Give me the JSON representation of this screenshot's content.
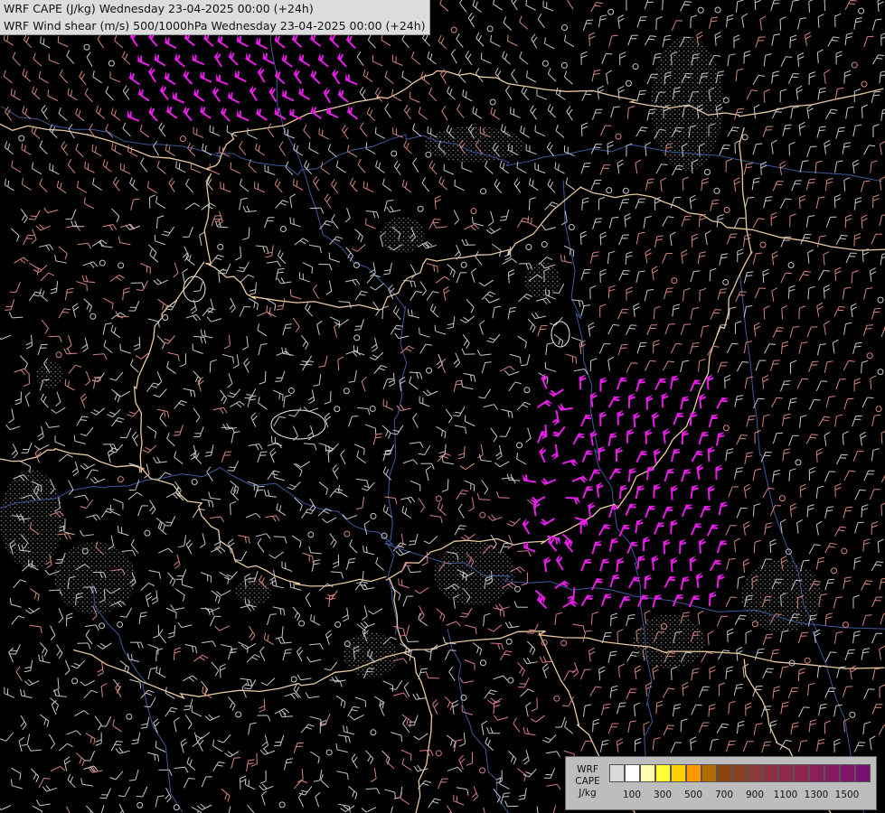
{
  "header": {
    "title_line1": "WRF CAPE (J/kg) Wednesday 23-04-2025 00:00 (+24h)",
    "title_line2": "WRF Wind shear (m/s) 500/1000hPa Wednesday 23-04-2025 00:00 (+24h)"
  },
  "legend": {
    "label_line1": "WRF",
    "label_line2": "CAPE",
    "label_line3": "J/kg",
    "colors": [
      "#d9d9d9",
      "#ffffff",
      "#ffffb0",
      "#ffff33",
      "#ffd000",
      "#ff9900",
      "#b36b00",
      "#8b4513",
      "#8a4020",
      "#8b3a3a",
      "#8e3040",
      "#8f2a48",
      "#8f2550",
      "#8b1f58",
      "#861a60",
      "#801468",
      "#7a1070"
    ],
    "ticks": [
      {
        "label": "100",
        "i": 1
      },
      {
        "label": "300",
        "i": 3
      },
      {
        "label": "500",
        "i": 5
      },
      {
        "label": "700",
        "i": 7
      },
      {
        "label": "900",
        "i": 9
      },
      {
        "label": "1100",
        "i": 11
      },
      {
        "label": "1300",
        "i": 13
      },
      {
        "label": "1500",
        "i": 15
      }
    ]
  },
  "map": {
    "icons": [
      "wind-barb-icon",
      "calm-wind-circle-icon",
      "border-line",
      "river-line",
      "cape-stipple-area"
    ],
    "barb_colors": {
      "light": "#c8c8c8",
      "salmon": "#d7877e",
      "pink": "#d97b90",
      "magenta": "#e61ee6"
    }
  }
}
